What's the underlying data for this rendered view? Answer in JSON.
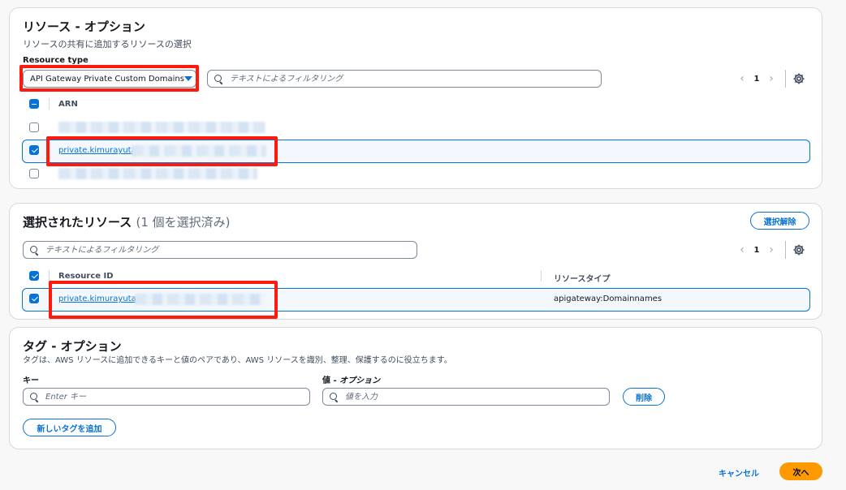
{
  "resources_panel": {
    "title": "リソース - オプション",
    "description": "リソースの共有に追加するリソースの選択",
    "resource_type_label": "Resource type",
    "resource_type_value": "API Gateway Private Custom Domains",
    "filter_placeholder": "テキストによるフィルタリング",
    "page": "1",
    "column_arn": "ARN",
    "rows": [
      {
        "checked": false,
        "arn": ""
      },
      {
        "checked": true,
        "arn": "private.kimurayuta"
      },
      {
        "checked": false,
        "arn": ""
      }
    ]
  },
  "selected_panel": {
    "title": "選択されたリソース",
    "count_text": "(1 個を選択済み)",
    "deselect_label": "選択解除",
    "filter_placeholder": "テキストによるフィルタリング",
    "page": "1",
    "column_resource_id": "Resource ID",
    "column_resource_type": "リソースタイプ",
    "rows": [
      {
        "checked": true,
        "resource_id": "private.kimurayuta.",
        "resource_type": "apigateway:Domainnames"
      }
    ]
  },
  "tags_panel": {
    "title": "タグ - オプション",
    "description": "タグは、AWS リソースに追加できるキーと値のペアであり、AWS リソースを識別、整理、保護するのに役立ちます。",
    "key_label": "キー",
    "value_label": "値",
    "value_optional": "オプション",
    "value_label_sep": " - ",
    "key_placeholder": "Enter キー",
    "value_placeholder": "値を入力",
    "remove_label": "削除",
    "add_tag_label": "新しいタグを追加"
  },
  "footer": {
    "cancel_label": "キャンセル",
    "next_label": "次へ"
  },
  "colors": {
    "accent": "#0972d3",
    "highlight": "#ff1a0e",
    "primary": "#ff9900"
  }
}
